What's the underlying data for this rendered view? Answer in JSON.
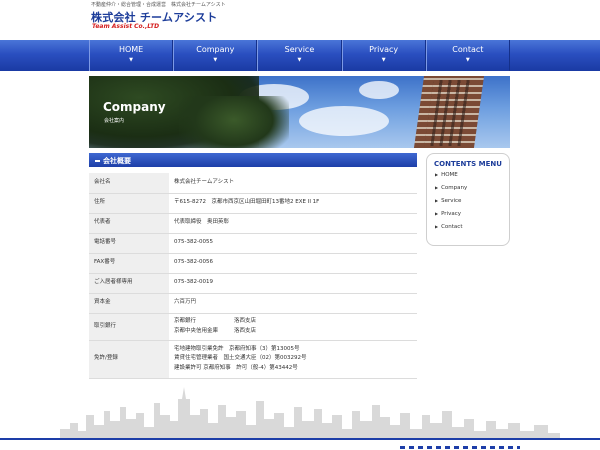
{
  "header": {
    "tagline": "不動産仲介・総合管理・合成運営　株式会社チームアシスト",
    "logo_jp": "株式会社 チームアシスト",
    "logo_en": "Team Assist Co.,LTD"
  },
  "nav": {
    "items": [
      {
        "label": "HOME"
      },
      {
        "label": "Company"
      },
      {
        "label": "Service"
      },
      {
        "label": "Privacy"
      },
      {
        "label": "Contact"
      }
    ],
    "arrow": "▼"
  },
  "hero": {
    "title": "Company",
    "subtitle": "会社案内"
  },
  "section": {
    "title": "会社概要"
  },
  "info": {
    "company_label": "会社名",
    "company_value": "株式会社チームアシスト",
    "address_label": "住所",
    "address_value": "〒615-8272　京都市西京区山田堀田町13番地2 EXE II 1F",
    "rep_label": "代表者",
    "rep_value": "代表取締役　奥田英彰",
    "tel_label": "電話番号",
    "tel_value": "075-382-0055",
    "fax_label": "FAX番号",
    "fax_value": "075-382-0056",
    "resident_label": "ご入居者様専用",
    "resident_value": "075-382-0019",
    "capital_label": "資本金",
    "capital_value": "六百万円",
    "bank_label": "取引銀行",
    "bank1_name": "京都銀行",
    "bank1_branch": "洛西支店",
    "bank2_name": "京都中央信用金庫",
    "bank2_branch": "洛西支店",
    "license_label": "免許/登録",
    "license1": "宅地建物取引業免許　京都府知事（3）第13005号",
    "license2": "賃貸住宅管理業者　国土交通大臣（02）第003292号",
    "license3": "建設業許可 京都府知事　許可（般-4）第43442号"
  },
  "sidebar": {
    "title": "CONTENTS MENU",
    "bullet": "▶",
    "items": [
      {
        "label": "HOME"
      },
      {
        "label": "Company"
      },
      {
        "label": "Service"
      },
      {
        "label": "Privacy"
      },
      {
        "label": "Contact"
      }
    ]
  },
  "colors": {
    "nav_blue": "#2a4fc0",
    "logo_blue": "#1d3d9a",
    "logo_red": "#d41e1e"
  }
}
